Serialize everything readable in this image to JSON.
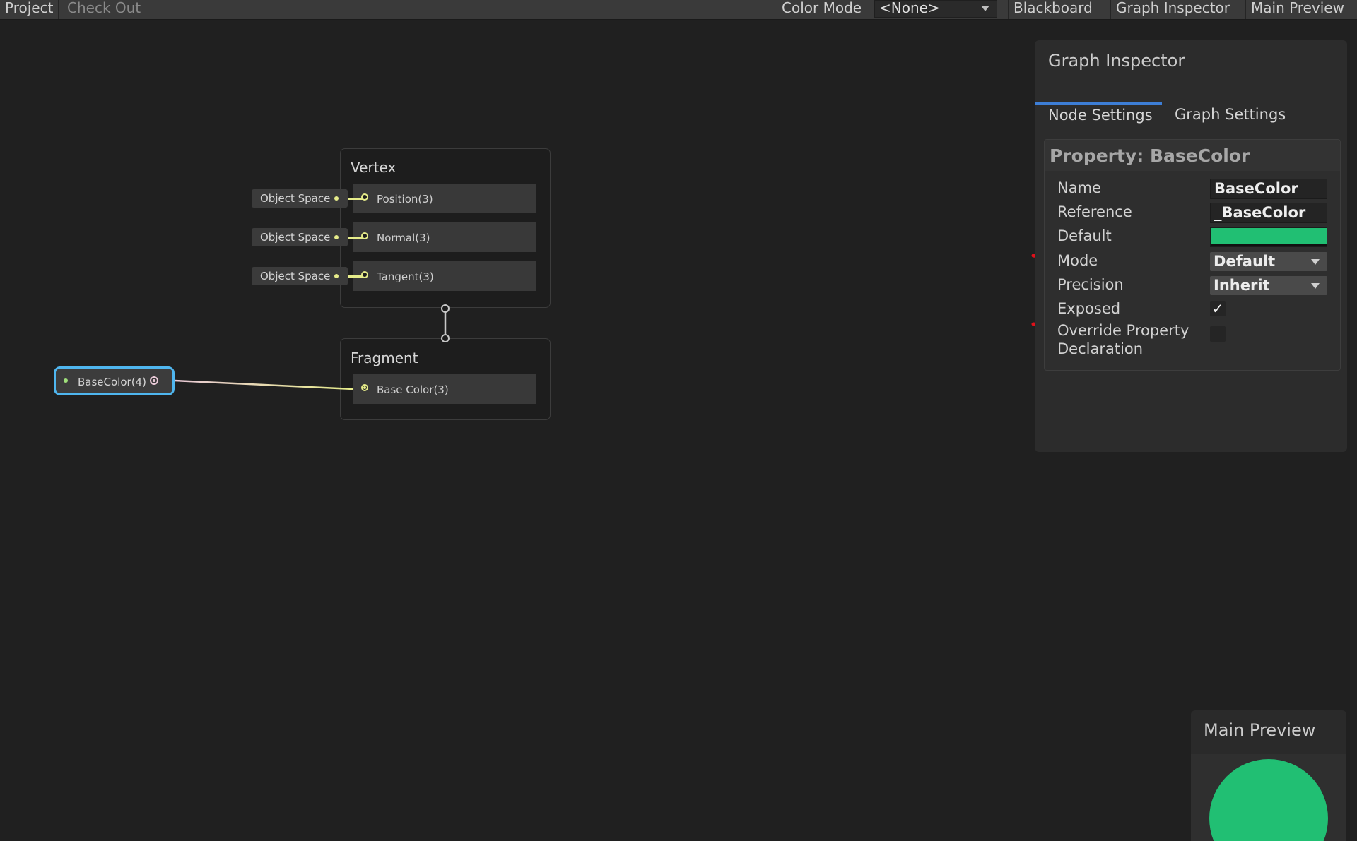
{
  "toolbar": {
    "project": "Project",
    "check_out": "Check Out",
    "color_mode_label": "Color Mode",
    "color_mode_value": "<None>",
    "blackboard": "Blackboard",
    "graph_inspector": "Graph Inspector",
    "main_preview": "Main Preview"
  },
  "graph": {
    "vertex": {
      "title": "Vertex",
      "blocks": [
        {
          "label": "Position(3)",
          "space": "Object Space"
        },
        {
          "label": "Normal(3)",
          "space": "Object Space"
        },
        {
          "label": "Tangent(3)",
          "space": "Object Space"
        }
      ]
    },
    "fragment": {
      "title": "Fragment",
      "blocks": [
        {
          "label": "Base Color(3)"
        }
      ]
    },
    "property_node": {
      "label": "BaseColor(4)"
    }
  },
  "inspector": {
    "title": "Graph Inspector",
    "tabs": [
      "Node Settings",
      "Graph Settings"
    ],
    "active_tab": "Node Settings",
    "section_title": "Property: BaseColor",
    "fields": {
      "name_label": "Name",
      "name_value": "BaseColor",
      "reference_label": "Reference",
      "reference_value": "_BaseColor",
      "default_label": "Default",
      "default_color": "#21bf73",
      "mode_label": "Mode",
      "mode_value": "Default",
      "precision_label": "Precision",
      "precision_value": "Inherit",
      "exposed_label": "Exposed",
      "exposed_checked": true,
      "exposed_mark": "✓",
      "override_label_line1": "Override Property",
      "override_label_line2": "Declaration",
      "override_checked": false
    }
  },
  "main_preview": {
    "title": "Main Preview",
    "sphere_color": "#21bf73"
  },
  "colors": {
    "annotation": "#e0101a",
    "selection": "#4fb6ef",
    "vector_port": "#e6ec8a"
  }
}
